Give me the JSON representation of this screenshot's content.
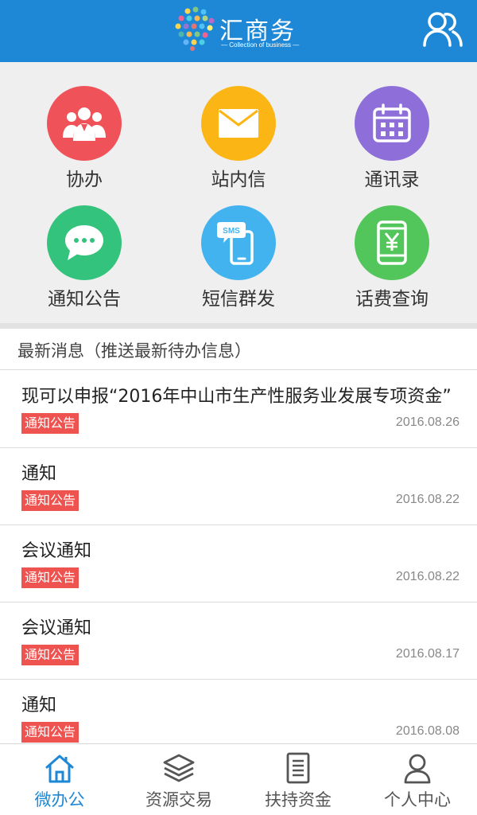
{
  "header": {
    "logo_title": "汇商务",
    "logo_subtitle": "— Collection of business —",
    "user_icon": "users-icon",
    "color": "#1e88d6"
  },
  "grid": [
    {
      "label": "协办",
      "icon": "people-group-icon",
      "color": "#f0525a"
    },
    {
      "label": "站内信",
      "icon": "envelope-icon",
      "color": "#fbb515"
    },
    {
      "label": "通讯录",
      "icon": "calendar-icon",
      "color": "#8e6fd9"
    },
    {
      "label": "通知公告",
      "icon": "chat-bubble-icon",
      "color": "#33c37c"
    },
    {
      "label": "短信群发",
      "icon": "sms-phone-icon",
      "color": "#43b3ef"
    },
    {
      "label": "话费查询",
      "icon": "yen-phone-icon",
      "color": "#52c65a"
    }
  ],
  "news": {
    "section_title": "最新消息（推送最新待办信息）",
    "items": [
      {
        "title": "现可以申报“2016年中山市生产性服务业发展专项资金”",
        "tag": "通知公告",
        "date": "2016.08.26"
      },
      {
        "title": "通知",
        "tag": "通知公告",
        "date": "2016.08.22"
      },
      {
        "title": "会议通知",
        "tag": "通知公告",
        "date": "2016.08.22"
      },
      {
        "title": "会议通知",
        "tag": "通知公告",
        "date": "2016.08.17"
      },
      {
        "title": "通知",
        "tag": "通知公告",
        "date": "2016.08.08"
      }
    ],
    "tag_color": "#ef5350"
  },
  "tabbar": {
    "items": [
      {
        "label": "微办公",
        "icon": "home-icon",
        "active": true
      },
      {
        "label": "资源交易",
        "icon": "layers-icon",
        "active": false
      },
      {
        "label": "扶持资金",
        "icon": "document-icon",
        "active": false
      },
      {
        "label": "个人中心",
        "icon": "person-icon",
        "active": false
      }
    ],
    "active_color": "#1e88d6"
  }
}
